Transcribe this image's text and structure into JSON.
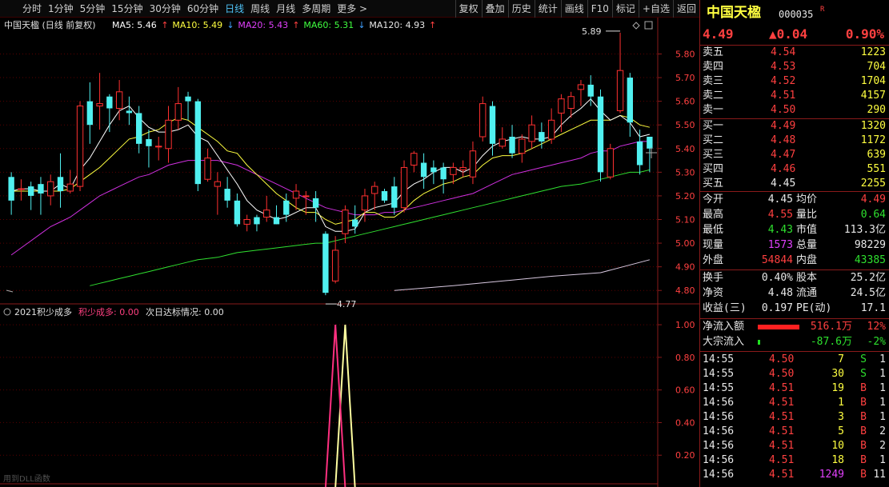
{
  "toolbar": {
    "tabs": [
      "分时",
      "1分钟",
      "5分钟",
      "15分钟",
      "30分钟",
      "60分钟",
      "日线",
      "周线",
      "月线",
      "多周期",
      "更多 >"
    ],
    "active": "日线",
    "right": [
      "复权",
      "叠加",
      "历史",
      "统计",
      "画线",
      "F10",
      "标记",
      "+自选",
      "返回"
    ]
  },
  "main_chart": {
    "title": "中国天楹 (日线 前复权)",
    "ma": [
      {
        "label": "MA5: 5.46",
        "arrow": "↑",
        "color": "#ffffff"
      },
      {
        "label": "MA10: 5.49",
        "arrow": "↓",
        "color": "#ffff40"
      },
      {
        "label": "MA20: 5.43",
        "arrow": "↑",
        "color": "#e040fb"
      },
      {
        "label": "MA60: 5.31",
        "arrow": "↓",
        "color": "#40ff40"
      },
      {
        "label": "MA120: 4.93",
        "arrow": "↑",
        "color": "#e8e8e8"
      }
    ],
    "yticks": [
      "5.80",
      "5.70",
      "5.60",
      "5.50",
      "5.40",
      "5.30",
      "5.20",
      "5.10",
      "5.00",
      "4.90",
      "4.80"
    ],
    "high_label": "5.89",
    "low_label": "4.77"
  },
  "indicator": {
    "name": "2021积少成多",
    "series1": "积少成多: 0.00",
    "series2": "次日达标情况: 0.00",
    "yticks": [
      "1.00",
      "0.80",
      "0.60",
      "0.40",
      "0.20"
    ],
    "footer": "用到DLL函数"
  },
  "chart_data": {
    "type": "candlestick",
    "ylim": [
      4.75,
      5.92
    ],
    "candles": [
      [
        5.28,
        5.18,
        5.3,
        5.12
      ],
      [
        5.23,
        5.23,
        5.27,
        5.18
      ],
      [
        5.24,
        5.2,
        5.26,
        5.14
      ],
      [
        5.25,
        5.21,
        5.28,
        5.12
      ],
      [
        5.2,
        5.26,
        5.29,
        5.16
      ],
      [
        5.28,
        5.22,
        5.38,
        5.15
      ],
      [
        5.22,
        5.25,
        5.31,
        5.21
      ],
      [
        5.24,
        5.58,
        5.6,
        5.22
      ],
      [
        5.6,
        5.5,
        5.68,
        5.42
      ],
      [
        5.58,
        5.59,
        5.72,
        5.48
      ],
      [
        5.62,
        5.57,
        5.63,
        5.47
      ],
      [
        5.57,
        5.64,
        5.69,
        5.52
      ],
      [
        5.56,
        5.55,
        5.62,
        5.5
      ],
      [
        5.55,
        5.42,
        5.58,
        5.38
      ],
      [
        5.44,
        5.41,
        5.48,
        5.32
      ],
      [
        5.41,
        5.41,
        5.45,
        5.35
      ],
      [
        5.4,
        5.52,
        5.58,
        5.34
      ],
      [
        5.52,
        5.59,
        5.66,
        5.48
      ],
      [
        5.62,
        5.6,
        5.64,
        5.52
      ],
      [
        5.6,
        5.25,
        5.61,
        5.22
      ],
      [
        5.27,
        5.36,
        5.4,
        5.26
      ],
      [
        5.24,
        5.26,
        5.3,
        5.12
      ],
      [
        5.23,
        5.18,
        5.28,
        5.15
      ],
      [
        5.18,
        5.08,
        5.21,
        5.07
      ],
      [
        5.08,
        5.1,
        5.12,
        5.05
      ],
      [
        5.11,
        5.08,
        5.12,
        5.05
      ],
      [
        5.11,
        5.14,
        5.2,
        5.09
      ],
      [
        5.11,
        5.08,
        5.16,
        5.08
      ],
      [
        5.18,
        5.12,
        5.21,
        5.09
      ],
      [
        5.19,
        5.22,
        5.25,
        5.14
      ],
      [
        5.2,
        5.2,
        5.22,
        5.12
      ],
      [
        5.19,
        5.15,
        5.22,
        5.09
      ],
      [
        5.04,
        4.79,
        5.05,
        4.78
      ],
      [
        4.84,
        4.97,
        5.03,
        4.83
      ],
      [
        5.04,
        5.14,
        5.16,
        5.0
      ],
      [
        5.1,
        5.07,
        5.16,
        5.04
      ],
      [
        5.14,
        5.2,
        5.23,
        5.09
      ],
      [
        5.21,
        5.24,
        5.26,
        5.14
      ],
      [
        5.22,
        5.18,
        5.23,
        5.17
      ],
      [
        5.24,
        5.15,
        5.28,
        5.12
      ],
      [
        5.15,
        5.32,
        5.35,
        5.13
      ],
      [
        5.33,
        5.38,
        5.39,
        5.3
      ],
      [
        5.34,
        5.28,
        5.38,
        5.23
      ],
      [
        5.32,
        5.3,
        5.35,
        5.25
      ],
      [
        5.32,
        5.27,
        5.34,
        5.21
      ],
      [
        5.29,
        5.32,
        5.34,
        5.25
      ],
      [
        5.31,
        5.32,
        5.35,
        5.28
      ],
      [
        5.28,
        5.39,
        5.43,
        5.25
      ],
      [
        5.45,
        5.59,
        5.62,
        5.43
      ],
      [
        5.58,
        5.42,
        5.6,
        5.37
      ],
      [
        5.41,
        5.44,
        5.49,
        5.4
      ],
      [
        5.45,
        5.38,
        5.5,
        5.36
      ],
      [
        5.38,
        5.44,
        5.46,
        5.34
      ],
      [
        5.43,
        5.5,
        5.54,
        5.4
      ],
      [
        5.47,
        5.43,
        5.51,
        5.4
      ],
      [
        5.44,
        5.52,
        5.57,
        5.42
      ],
      [
        5.55,
        5.61,
        5.63,
        5.47
      ],
      [
        5.57,
        5.62,
        5.64,
        5.53
      ],
      [
        5.65,
        5.67,
        5.69,
        5.58
      ],
      [
        5.67,
        5.62,
        5.71,
        5.58
      ],
      [
        5.62,
        5.3,
        5.65,
        5.26
      ],
      [
        5.28,
        5.4,
        5.42,
        5.27
      ],
      [
        5.56,
        5.73,
        5.89,
        5.55
      ],
      [
        5.7,
        5.51,
        5.72,
        5.45
      ],
      [
        5.43,
        5.33,
        5.48,
        5.29
      ],
      [
        5.45,
        5.4,
        5.42,
        5.3
      ]
    ],
    "ma5": [
      5.22,
      5.23,
      5.23,
      5.22,
      5.22,
      5.25,
      5.23,
      5.31,
      5.36,
      5.43,
      5.5,
      5.56,
      5.58,
      5.53,
      5.49,
      5.47,
      5.47,
      5.48,
      5.5,
      5.45,
      5.43,
      5.37,
      5.31,
      5.25,
      5.18,
      5.14,
      5.12,
      5.1,
      5.11,
      5.13,
      5.15,
      5.15,
      5.07,
      5.05,
      5.05,
      5.06,
      5.13,
      5.15,
      5.16,
      5.17,
      5.22,
      5.25,
      5.27,
      5.3,
      5.32,
      5.32,
      5.3,
      5.32,
      5.37,
      5.41,
      5.43,
      5.44,
      5.45,
      5.44,
      5.44,
      5.45,
      5.5,
      5.54,
      5.57,
      5.61,
      5.56,
      5.52,
      5.54,
      5.51,
      5.45,
      5.46
    ],
    "ma10": [
      5.22,
      5.22,
      5.22,
      5.22,
      5.22,
      5.22,
      5.23,
      5.26,
      5.29,
      5.32,
      5.36,
      5.4,
      5.44,
      5.45,
      5.47,
      5.48,
      5.51,
      5.53,
      5.52,
      5.49,
      5.46,
      5.43,
      5.39,
      5.38,
      5.33,
      5.29,
      5.25,
      5.21,
      5.18,
      5.15,
      5.13,
      5.13,
      5.1,
      5.08,
      5.09,
      5.1,
      5.13,
      5.13,
      5.11,
      5.11,
      5.14,
      5.18,
      5.21,
      5.23,
      5.25,
      5.26,
      5.28,
      5.29,
      5.33,
      5.36,
      5.37,
      5.37,
      5.38,
      5.4,
      5.42,
      5.44,
      5.46,
      5.48,
      5.5,
      5.52,
      5.52,
      5.52,
      5.54,
      5.53,
      5.5,
      5.49
    ],
    "ma20": [
      4.95,
      4.98,
      5.01,
      5.04,
      5.07,
      5.09,
      5.11,
      5.14,
      5.17,
      5.2,
      5.22,
      5.24,
      5.26,
      5.28,
      5.29,
      5.31,
      5.33,
      5.34,
      5.35,
      5.35,
      5.35,
      5.35,
      5.34,
      5.33,
      5.31,
      5.29,
      5.27,
      5.25,
      5.23,
      5.21,
      5.19,
      5.17,
      5.15,
      5.14,
      5.13,
      5.12,
      5.12,
      5.12,
      5.13,
      5.13,
      5.14,
      5.15,
      5.16,
      5.17,
      5.18,
      5.19,
      5.2,
      5.21,
      5.23,
      5.25,
      5.27,
      5.29,
      5.3,
      5.31,
      5.32,
      5.33,
      5.34,
      5.35,
      5.36,
      5.38,
      5.39,
      5.39,
      5.41,
      5.42,
      5.43,
      5.43
    ],
    "ma60": [
      null,
      null,
      null,
      null,
      null,
      null,
      null,
      null,
      4.82,
      4.83,
      4.84,
      4.85,
      4.86,
      4.87,
      4.88,
      4.89,
      4.9,
      4.91,
      4.92,
      4.93,
      4.935,
      4.94,
      4.95,
      4.96,
      4.965,
      4.97,
      4.975,
      4.98,
      4.985,
      4.99,
      4.995,
      5.0,
      5.0,
      5.01,
      5.02,
      5.03,
      5.04,
      5.05,
      5.06,
      5.07,
      5.08,
      5.09,
      5.1,
      5.11,
      5.12,
      5.13,
      5.14,
      5.15,
      5.16,
      5.17,
      5.18,
      5.19,
      5.2,
      5.21,
      5.22,
      5.23,
      5.24,
      5.245,
      5.25,
      5.26,
      5.27,
      5.28,
      5.29,
      5.3,
      5.3,
      5.31
    ],
    "ma120": [
      null,
      null,
      null,
      null,
      null,
      null,
      null,
      null,
      null,
      null,
      null,
      null,
      null,
      null,
      null,
      null,
      null,
      null,
      null,
      null,
      null,
      null,
      null,
      null,
      null,
      null,
      null,
      null,
      null,
      null,
      null,
      null,
      null,
      null,
      null,
      null,
      null,
      null,
      null,
      null,
      null,
      null,
      null,
      null,
      null,
      null,
      null,
      null,
      null,
      null,
      null,
      null,
      null,
      null,
      null,
      null,
      null,
      null,
      null,
      null,
      null,
      null,
      null,
      null,
      null,
      null
    ],
    "ma120_points": [
      [
        39,
        4.8
      ],
      [
        45,
        4.82
      ],
      [
        50,
        4.84
      ],
      [
        55,
        4.86
      ],
      [
        60,
        4.875
      ],
      [
        65,
        4.93
      ]
    ],
    "indicator_series1_spike": {
      "index": 33,
      "value": 1.0
    },
    "indicator_series2_spike": {
      "index": 34,
      "value": 1.0
    }
  },
  "quote": {
    "name": "中国天楹",
    "code": "000035",
    "r_badge": "R",
    "price": "4.49",
    "change": "▲0.04",
    "pct": "0.90%",
    "asks": [
      {
        "label": "卖五",
        "price": "4.54",
        "vol": "1223"
      },
      {
        "label": "卖四",
        "price": "4.53",
        "vol": "704"
      },
      {
        "label": "卖三",
        "price": "4.52",
        "vol": "1704"
      },
      {
        "label": "卖二",
        "price": "4.51",
        "vol": "4157"
      },
      {
        "label": "卖一",
        "price": "4.50",
        "vol": "290"
      }
    ],
    "bids": [
      {
        "label": "买一",
        "price": "4.49",
        "vol": "1320"
      },
      {
        "label": "买二",
        "price": "4.48",
        "vol": "1172"
      },
      {
        "label": "买三",
        "price": "4.47",
        "vol": "639"
      },
      {
        "label": "买四",
        "price": "4.46",
        "vol": "551"
      },
      {
        "label": "买五",
        "price": "4.45",
        "vol": "2255"
      }
    ],
    "stats": [
      {
        "l1": "今开",
        "v1": "4.45",
        "c1": "white",
        "l2": "均价",
        "v2": "4.49",
        "c2": "red"
      },
      {
        "l1": "最高",
        "v1": "4.55",
        "c1": "red",
        "l2": "量比",
        "v2": "0.64",
        "c2": "green"
      },
      {
        "l1": "最低",
        "v1": "4.43",
        "c1": "green",
        "l2": "市值",
        "v2": "113.3亿",
        "c2": "white"
      },
      {
        "l1": "现量",
        "v1": "1573",
        "c1": "magenta",
        "l2": "总量",
        "v2": "98229",
        "c2": "white"
      },
      {
        "l1": "外盘",
        "v1": "54844",
        "c1": "red",
        "l2": "内盘",
        "v2": "43385",
        "c2": "green"
      }
    ],
    "stats2": [
      {
        "l1": "换手",
        "v1": "0.40%",
        "l2": "股本",
        "v2": "25.2亿"
      },
      {
        "l1": "净资",
        "v1": "4.48",
        "l2": "流通",
        "v2": "24.5亿"
      },
      {
        "l1": "收益(三)",
        "v1": "0.197",
        "l2": "PE(动)",
        "v2": "17.1"
      }
    ],
    "flows": [
      {
        "label": "净流入额",
        "value": "516.1万",
        "pct": "12%",
        "bar": 0.9,
        "color": "#ff2020",
        "vcolor": "red"
      },
      {
        "label": "大宗流入",
        "value": "-87.6万",
        "pct": "-2%",
        "bar": 0.05,
        "color": "#20e020",
        "vcolor": "green"
      }
    ],
    "ticks": [
      {
        "t": "14:55",
        "p": "4.50",
        "v": "7",
        "s": "S",
        "n": "1",
        "vc": "yellow"
      },
      {
        "t": "14:55",
        "p": "4.50",
        "v": "30",
        "s": "S",
        "n": "1",
        "vc": "yellow"
      },
      {
        "t": "14:55",
        "p": "4.51",
        "v": "19",
        "s": "B",
        "n": "1",
        "vc": "yellow"
      },
      {
        "t": "14:56",
        "p": "4.51",
        "v": "1",
        "s": "B",
        "n": "1",
        "vc": "yellow"
      },
      {
        "t": "14:56",
        "p": "4.51",
        "v": "3",
        "s": "B",
        "n": "1",
        "vc": "yellow"
      },
      {
        "t": "14:56",
        "p": "4.51",
        "v": "5",
        "s": "B",
        "n": "2",
        "vc": "yellow"
      },
      {
        "t": "14:56",
        "p": "4.51",
        "v": "10",
        "s": "B",
        "n": "2",
        "vc": "yellow"
      },
      {
        "t": "14:56",
        "p": "4.51",
        "v": "18",
        "s": "B",
        "n": "1",
        "vc": "yellow"
      },
      {
        "t": "14:56",
        "p": "4.51",
        "v": "1249",
        "s": "B",
        "n": "11",
        "vc": "magenta"
      }
    ]
  }
}
